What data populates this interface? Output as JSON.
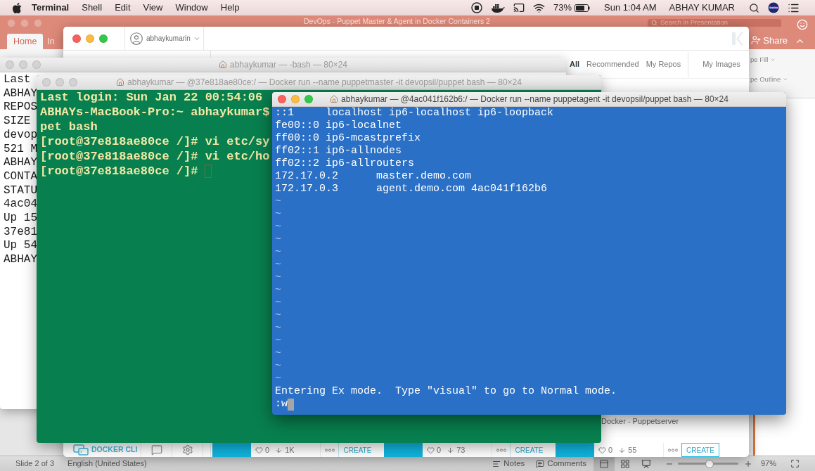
{
  "menu_bar": {
    "app": "Terminal",
    "menus": [
      "Shell",
      "Edit",
      "View",
      "Window",
      "Help"
    ],
    "battery": "73%",
    "clock": "Sun 1:04 AM",
    "user": "ABHAY KUMAR"
  },
  "powerpoint": {
    "active": false,
    "title": "DevOps - Puppet Master & Agent in Docker Containers 2",
    "search": {
      "placeholder": "Search in Presentation"
    },
    "share": "Share",
    "tabs": [
      {
        "label": "Home",
        "selected": true
      },
      {
        "label": "In",
        "selected": false
      }
    ],
    "ribbon_items": [
      "pe Fill",
      "pe Outline"
    ],
    "status_bar": {
      "slide": "Slide 2 of 3",
      "language": "English (United States)",
      "notes": "Notes",
      "comments": "Comments",
      "views": [
        {
          "kind": "normal",
          "selected": true
        },
        {
          "kind": "sorter",
          "selected": false
        },
        {
          "kind": "presenter",
          "selected": false
        }
      ],
      "zoom_slider": {
        "level": 0.52
      },
      "zoom": "97%"
    }
  },
  "kitematic": {
    "active": true,
    "user": "abhaykumarin",
    "tabs": [
      {
        "label": "All",
        "selected": true
      },
      {
        "label": "Recommended",
        "selected": false
      },
      {
        "label": "My Repos",
        "selected": false
      },
      {
        "label": "My Images",
        "selected": false
      }
    ],
    "docker_cli": "DOCKER CLI",
    "cards": [
      {
        "likes": "0",
        "pulls": "1K",
        "action": "CREATE",
        "highlighted": false
      },
      {
        "likes": "0",
        "pulls": "73",
        "action": "CREATE",
        "highlighted": false
      },
      {
        "title": "Docker - Puppetserver",
        "likes": "0",
        "pulls": "55",
        "action": "CREATE",
        "highlighted": true
      }
    ]
  },
  "terminals": [
    {
      "active": false,
      "title": "abhaykumar — -bash — 80×24",
      "lines": [
        "Last",
        "ABHAY",
        "REPOS",
        "SIZE",
        "devop",
        "521 M",
        "ABHAY",
        "CONTA",
        "STATU",
        "4ac04",
        "Up 15",
        "37e81",
        "Up 54",
        "ABHAY"
      ]
    },
    {
      "active": false,
      "title": "abhaykumar — @37e818ae80ce:/ — Docker run --name puppetmaster -it devopsil/puppet bash — 80×24",
      "lines": [
        "Last login: Sun Jan 22 00:54:06",
        "ABHAYs-MacBook-Pro:~ abhaykumar$",
        "pet bash",
        "[root@37e818ae80ce /]# vi etc/sy",
        "[root@37e818ae80ce /]# vi etc/ho",
        "[root@37e818ae80ce /]#"
      ]
    },
    {
      "active": true,
      "title": "abhaykumar — @4ac041f162b6:/ — Docker run --name puppetagent -it devopsil/puppet bash — 80×24",
      "lines": [
        "::1     localhost ip6-localhost ip6-loopback",
        "fe00::0 ip6-localnet",
        "ff00::0 ip6-mcastprefix",
        "ff02::1 ip6-allnodes",
        "ff02::2 ip6-allrouters",
        "172.17.0.2      master.demo.com",
        "172.17.0.3      agent.demo.com 4ac041f162b6",
        "~",
        "~",
        "~",
        "~",
        "~",
        "~",
        "~",
        "~",
        "~",
        "~",
        "~",
        "~",
        "~",
        "~",
        "~",
        "Entering Ex mode.  Type \"visual\" to go to Normal mode.",
        ":w"
      ]
    }
  ]
}
